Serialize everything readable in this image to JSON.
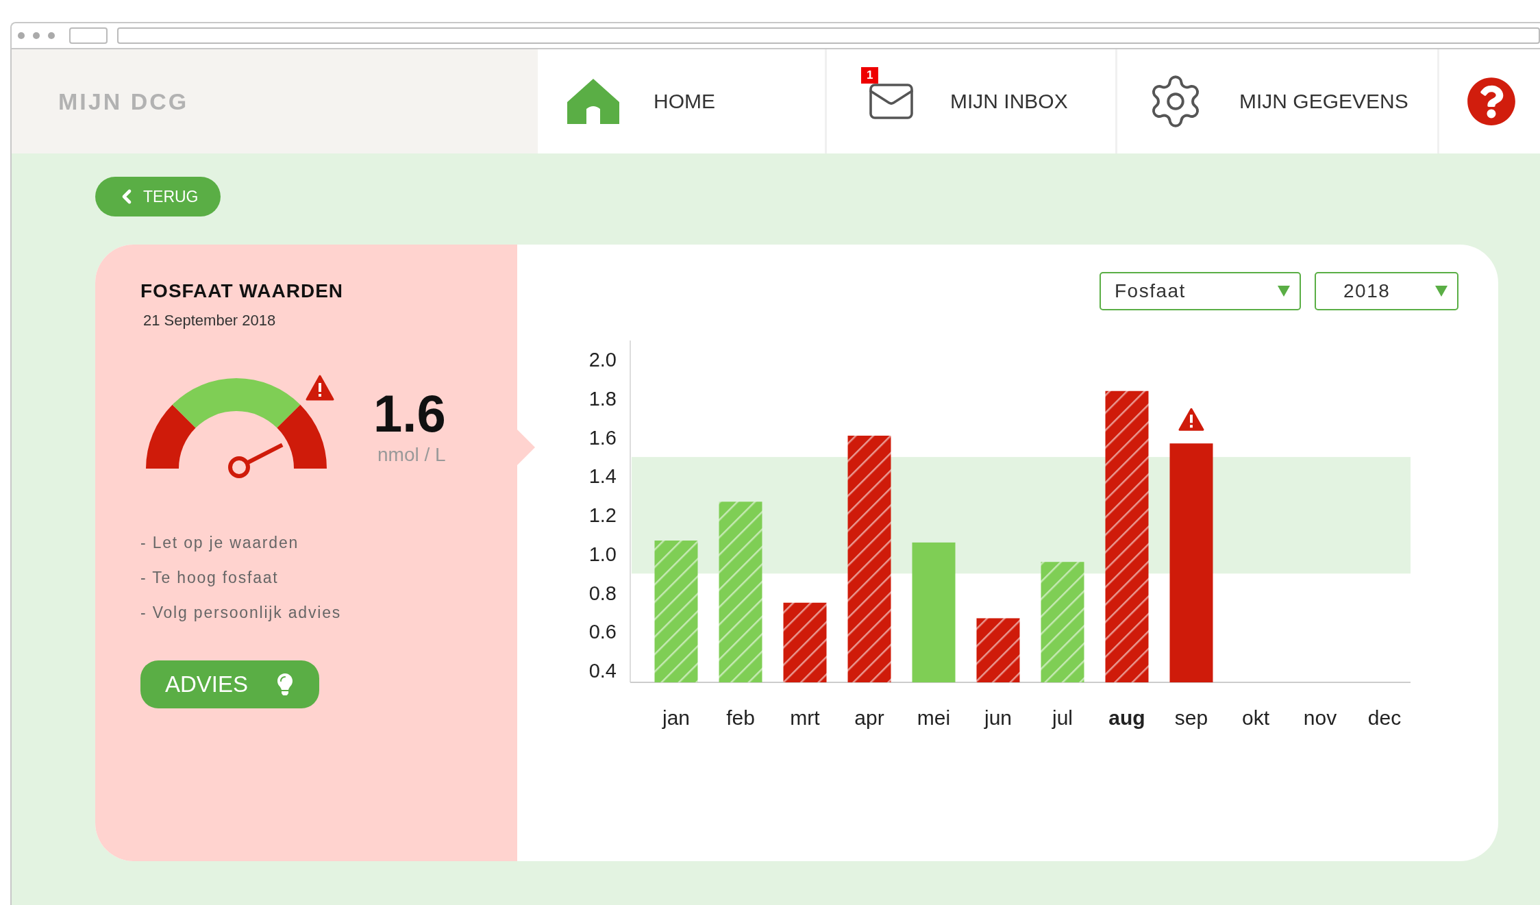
{
  "header": {
    "logo": "MIJN DCG",
    "nav": [
      {
        "kind": "home",
        "label": "HOME",
        "selected": false
      },
      {
        "kind": "inbox",
        "label": "MIJN INBOX",
        "badge": "1",
        "selected": false
      },
      {
        "kind": "settings",
        "label": "MIJN GEGEVENS",
        "selected": false
      },
      {
        "kind": "help",
        "selected": false
      }
    ]
  },
  "back_button": "TERUG",
  "summary": {
    "title": "FOSFAAT WAARDEN",
    "date": "21 September 2018",
    "gauge": {
      "warning": true
    },
    "value": "1.6",
    "unit": "nmol / L",
    "notes": [
      "- Let op je waarden",
      "- Te hoog fosfaat",
      "- Volg persoonlijk advies"
    ],
    "advice_button": "ADVIES"
  },
  "filters": [
    {
      "value": "Fosfaat"
    },
    {
      "value": "2018"
    }
  ],
  "chart": {
    "chart_data": {
      "type": "bar",
      "stacked": true,
      "categories": [
        "jan",
        "feb",
        "mrt",
        "apr",
        "mei",
        "jun",
        "jul",
        "aug",
        "sep",
        "okt",
        "nov",
        "dec"
      ],
      "series": [
        {
          "color": "#7fce55",
          "values": [
            1.07,
            1.27,
            null,
            null,
            1.06,
            null,
            0.96,
            null,
            null,
            null,
            null,
            null
          ]
        },
        {
          "color": "#cf1b0a",
          "values": [
            null,
            null,
            0.75,
            1.61,
            null,
            0.67,
            null,
            1.84,
            1.57,
            null,
            null,
            null
          ]
        }
      ],
      "ylim": [
        0.34,
        2.1
      ],
      "yticks": [
        {
          "value": 0.4,
          "label": "0.4"
        },
        {
          "value": 0.6,
          "label": "0.6"
        },
        {
          "value": 0.8,
          "label": "0.8"
        },
        {
          "value": 1.0,
          "label": "1.0"
        },
        {
          "value": 1.2,
          "label": "1.2"
        },
        {
          "value": 1.4,
          "label": "1.4"
        },
        {
          "value": 1.6,
          "label": "1.6"
        },
        {
          "value": 1.8,
          "label": "1.8"
        },
        {
          "value": 2.0,
          "label": "2.0"
        }
      ],
      "bands": [
        {
          "axis": "y",
          "from": 0.9,
          "to": 1.5
        }
      ]
    },
    "bar_styles": [
      {
        "hatched": true,
        "warning": false
      },
      {
        "hatched": true,
        "warning": false
      },
      {
        "hatched": true,
        "warning": false
      },
      {
        "hatched": true,
        "warning": false
      },
      {
        "hatched": false,
        "warning": false
      },
      {
        "hatched": true,
        "warning": false
      },
      {
        "hatched": true,
        "warning": false
      },
      {
        "hatched": true,
        "warning": false
      },
      {
        "hatched": false,
        "warning": true
      }
    ],
    "month_states": [
      {
        "selected": false
      },
      {
        "selected": false
      },
      {
        "selected": false
      },
      {
        "selected": false
      },
      {
        "selected": false
      },
      {
        "selected": false
      },
      {
        "selected": false
      },
      {
        "selected": true
      },
      {
        "selected": false
      },
      {
        "selected": false
      },
      {
        "selected": false
      },
      {
        "selected": false
      }
    ]
  }
}
